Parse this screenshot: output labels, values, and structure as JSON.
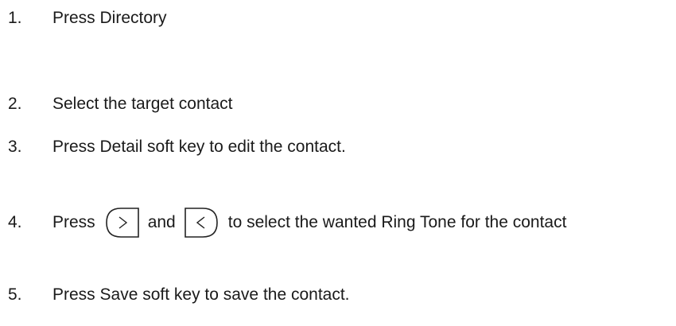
{
  "steps": [
    {
      "number": "1.",
      "text": "Press Directory"
    },
    {
      "number": "2.",
      "text": "Select the target contact"
    },
    {
      "number": "3.",
      "text": "Press Detail soft key to edit the contact."
    },
    {
      "number": "4.",
      "text_before": "Press",
      "text_middle": "and",
      "text_after": "to select the wanted Ring Tone for the contact",
      "icons": [
        "right-arrow-key-icon",
        "left-arrow-key-icon"
      ]
    },
    {
      "number": "5.",
      "text": "Press Save soft key to save the contact."
    }
  ]
}
